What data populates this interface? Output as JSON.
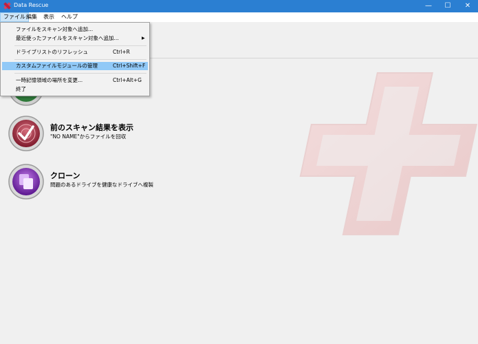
{
  "window": {
    "title": "Data Rescue",
    "minimize": "—",
    "maximize": "☐",
    "close": "✕"
  },
  "menubar": {
    "items": [
      "ファイル",
      "編集",
      "表示",
      "ヘルプ"
    ]
  },
  "file_menu": {
    "add_file": "ファイルをスキャン対象へ追加...",
    "recent_files": "最近使ったファイルをスキャン対象へ追加...",
    "refresh_drives": "ドライブリストのリフレッシュ",
    "refresh_shortcut": "Ctrl+R",
    "custom_modules": "カスタムファイルモジュールの管理",
    "custom_shortcut": "Ctrl+Shift+F",
    "temp_location": "一時記憶領域の場所を変更...",
    "temp_shortcut": "Ctrl+Alt+G",
    "exit": "終了"
  },
  "actions": [
    {
      "title": "前のスキャン結果を表示",
      "desc": "\"NO NAME\"からファイルを回収",
      "icon": "radar-check-icon",
      "color": "#a0283a"
    },
    {
      "title": "クローン",
      "desc": "問題のあるドライブを健康なドライブへ複製",
      "icon": "clone-icon",
      "color": "#7a2bb0"
    }
  ],
  "colors": {
    "titlebar": "#2b7fd2",
    "menu_highlight": "#91c9f7",
    "brand_cross": "#e8c4c4"
  }
}
